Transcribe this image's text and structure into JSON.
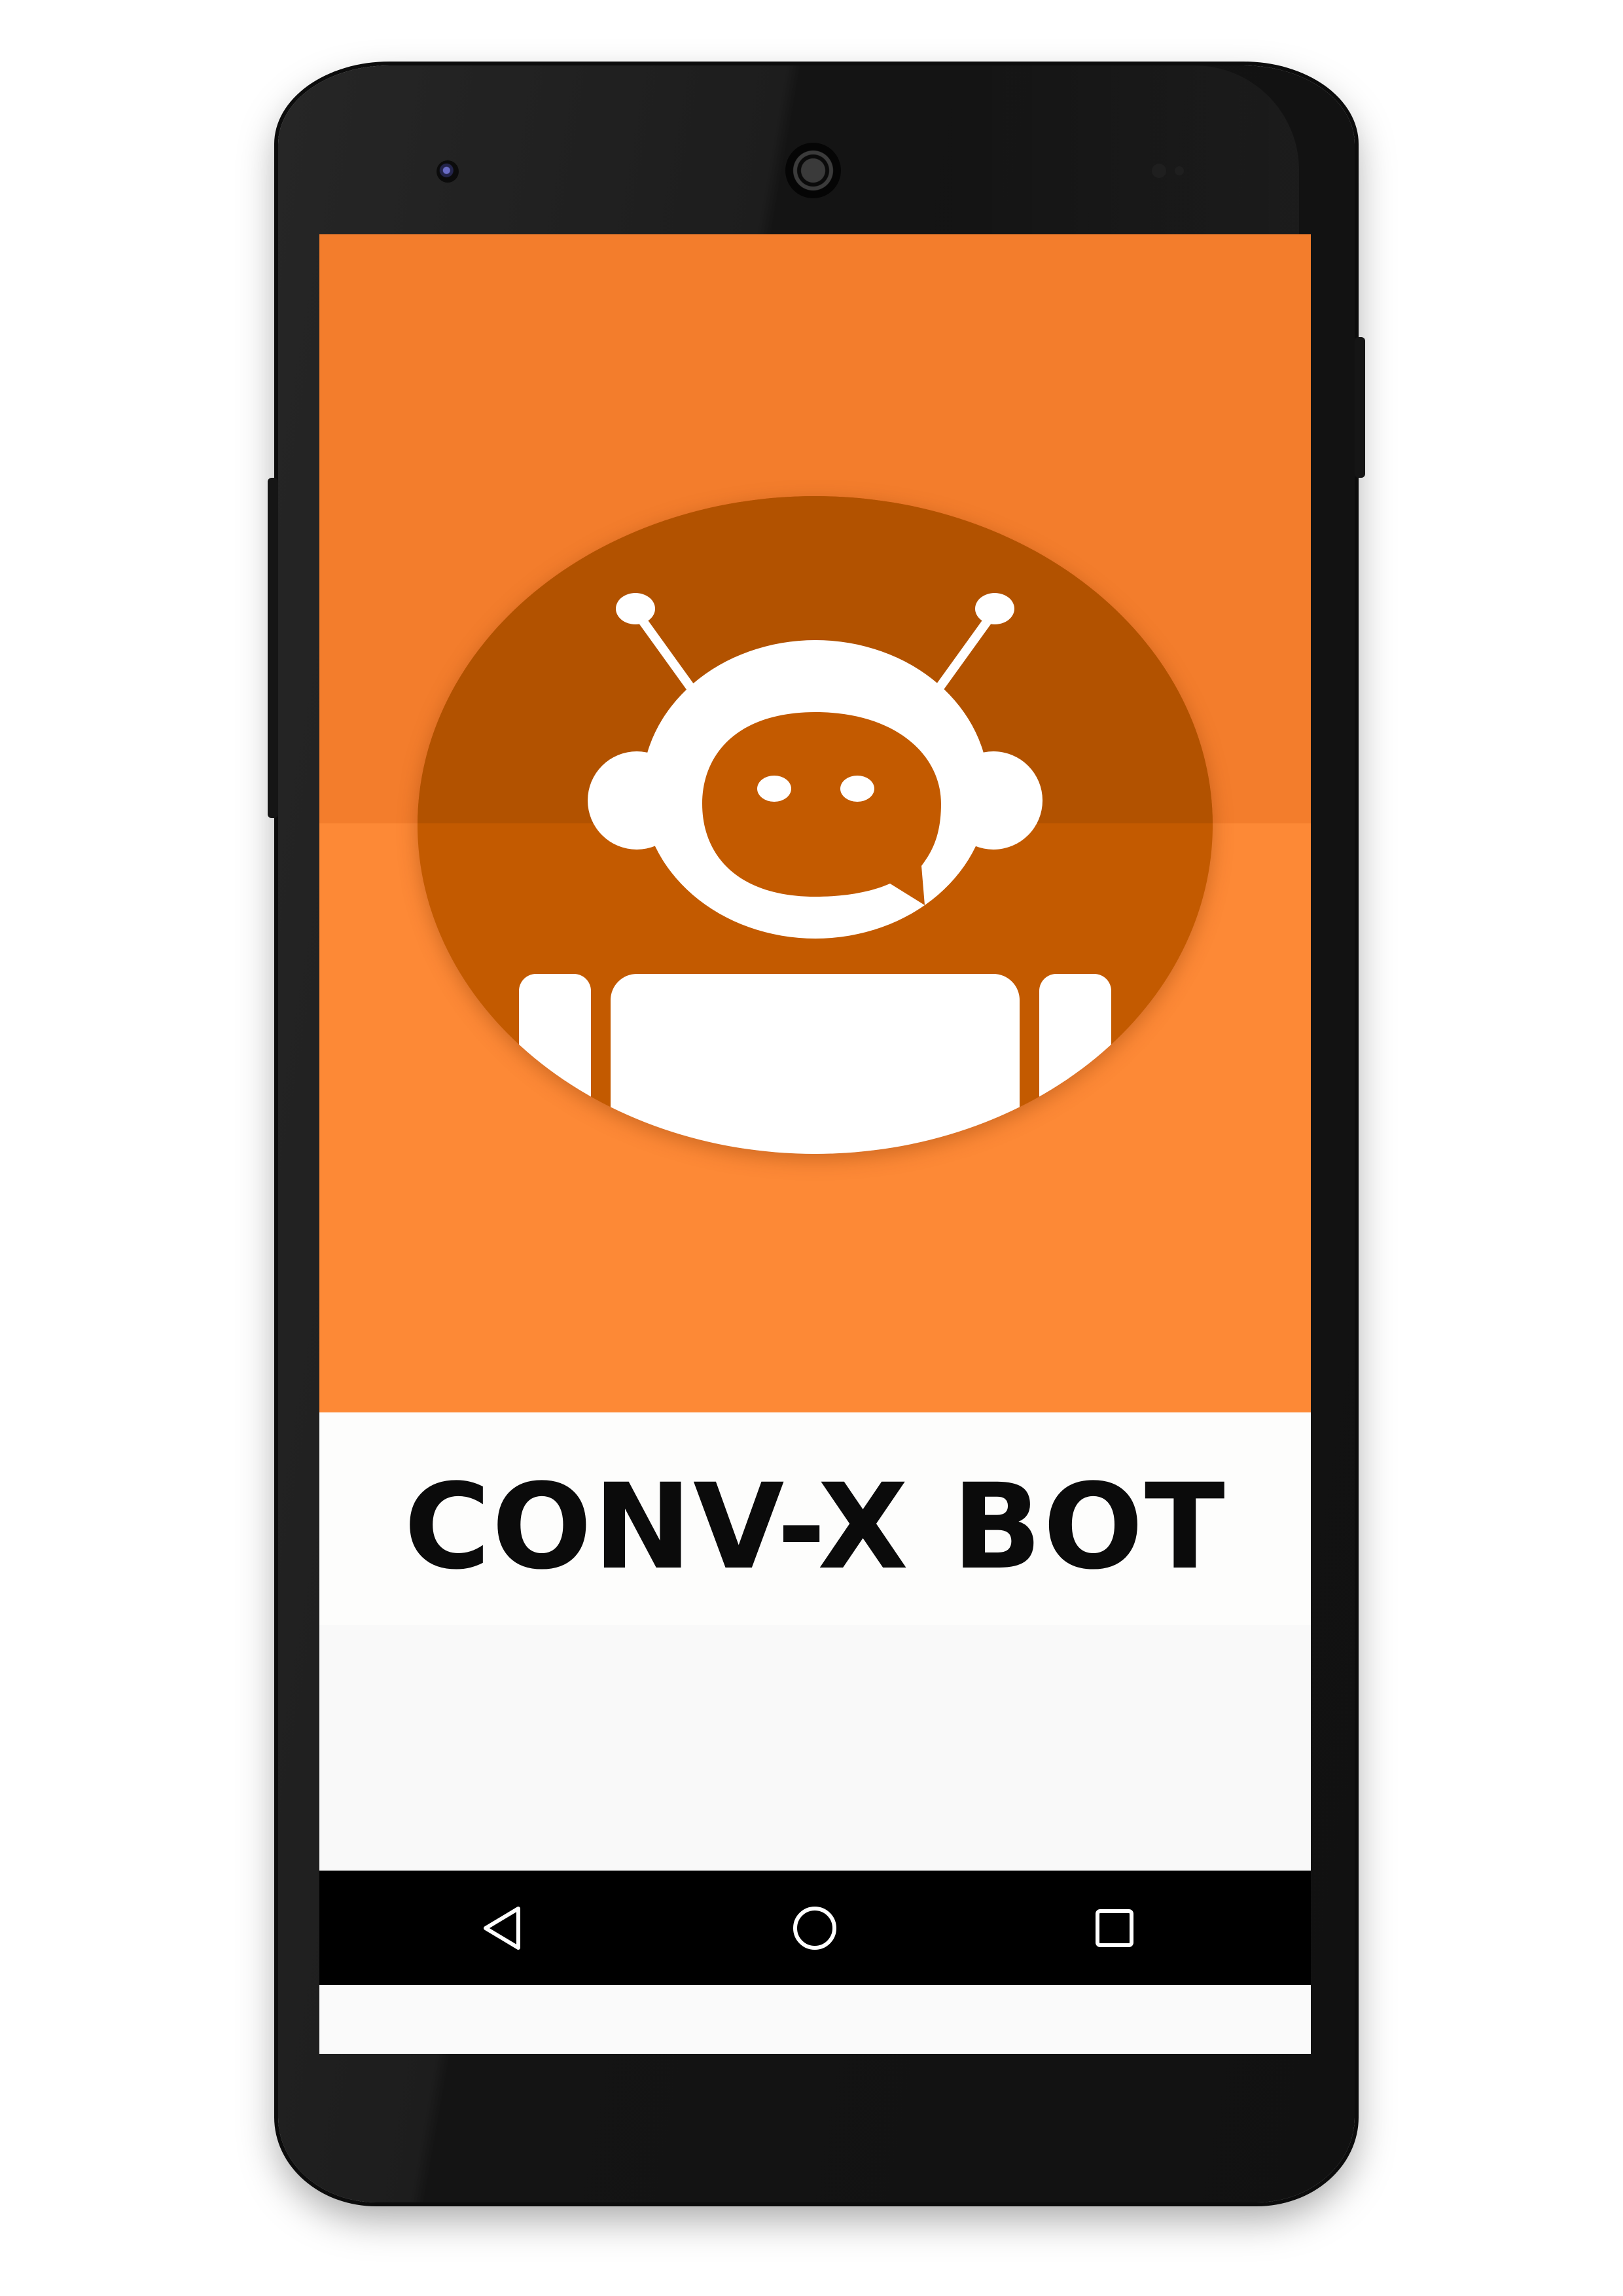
{
  "app": {
    "title": "CONV-X BOT"
  },
  "logo": {
    "icon": "robot-chat-icon"
  },
  "colors": {
    "hero_top": "#f37d2c",
    "hero_bottom": "#fd8936",
    "logo_dark": "#b25200",
    "logo_light": "#c35a00",
    "title_text": "#0b0b0b"
  },
  "navigation": {
    "back_icon": "back-triangle-icon",
    "home_icon": "home-circle-icon",
    "recents_icon": "recents-square-icon"
  }
}
